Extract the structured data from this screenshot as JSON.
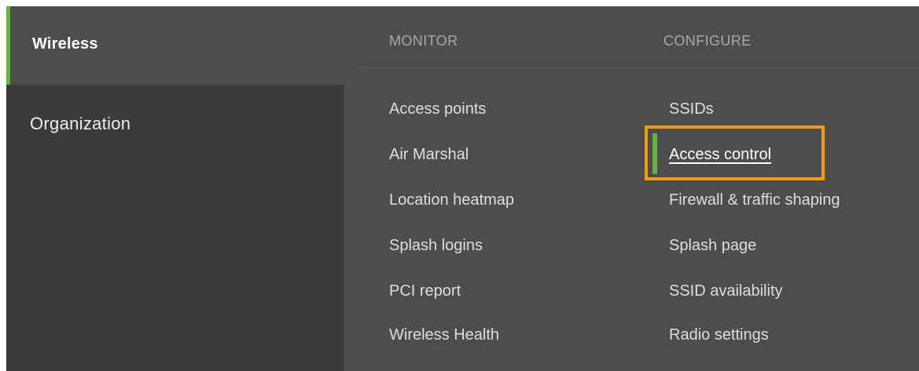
{
  "nav": {
    "items": [
      {
        "label": "Wireless",
        "active": true
      },
      {
        "label": "Organization",
        "active": false
      }
    ]
  },
  "monitor": {
    "header": "MONITOR",
    "items": [
      "Access points",
      "Air Marshal",
      "Location heatmap",
      "Splash logins",
      "PCI report",
      "Wireless Health"
    ]
  },
  "configure": {
    "header": "CONFIGURE",
    "items": [
      "SSIDs",
      "Access control",
      "Firewall & traffic shaping",
      "Splash page",
      "SSID availability",
      "Radio settings"
    ],
    "active_item": "Access control"
  },
  "colors": {
    "accent_green": "#66b045",
    "highlight_orange": "#f29a11",
    "panel_dark": "#3b3b3b",
    "panel": "#4d4d4d"
  }
}
